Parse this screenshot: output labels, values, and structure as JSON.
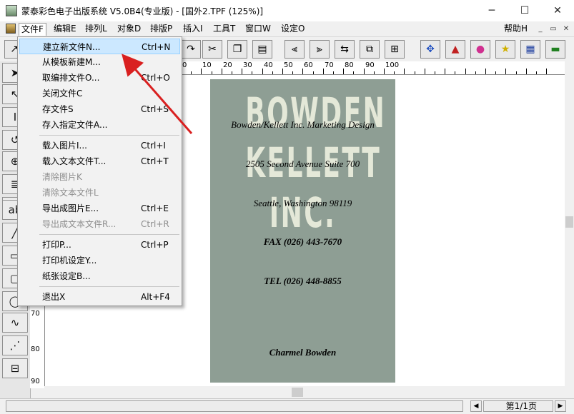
{
  "window": {
    "title": "蒙泰彩色电子出版系统 V5.0B4(专业版) - [国外2.TPF (125%)]",
    "minimize_glyph": "─",
    "maximize_glyph": "☐",
    "close_glyph": "✕"
  },
  "menubar": {
    "items": [
      "文件F",
      "编辑E",
      "排列L",
      "对象D",
      "排版P",
      "插入I",
      "工具T",
      "窗口W",
      "设定O"
    ],
    "help": "帮助H",
    "mdi_buttons": [
      "_",
      "▭",
      "✕"
    ]
  },
  "file_menu": {
    "groups": [
      [
        {
          "label": "建立新文件N...",
          "shortcut": "Ctrl+N",
          "state": "highlighted"
        },
        {
          "label": "从模板新建M...",
          "shortcut": "",
          "state": "enabled"
        },
        {
          "label": "取编排文件O...",
          "shortcut": "Ctrl+O",
          "state": "enabled"
        },
        {
          "label": "关闭文件C",
          "shortcut": "",
          "state": "enabled"
        },
        {
          "label": "存文件S",
          "shortcut": "Ctrl+S",
          "state": "enabled"
        },
        {
          "label": "存入指定文件A...",
          "shortcut": "",
          "state": "enabled"
        }
      ],
      [
        {
          "label": "载入图片I...",
          "shortcut": "Ctrl+I",
          "state": "enabled"
        },
        {
          "label": "载入文本文件T...",
          "shortcut": "Ctrl+T",
          "state": "enabled"
        },
        {
          "label": "清除图片K",
          "shortcut": "",
          "state": "disabled"
        },
        {
          "label": "清除文本文件L",
          "shortcut": "",
          "state": "disabled"
        },
        {
          "label": "导出成图片E...",
          "shortcut": "Ctrl+E",
          "state": "enabled"
        },
        {
          "label": "导出成文本文件R...",
          "shortcut": "Ctrl+R",
          "state": "disabled"
        }
      ],
      [
        {
          "label": "打印P...",
          "shortcut": "Ctrl+P",
          "state": "enabled"
        },
        {
          "label": "打印机设定Y...",
          "shortcut": "",
          "state": "enabled"
        },
        {
          "label": "纸张设定B...",
          "shortcut": "",
          "state": "enabled"
        }
      ],
      [
        {
          "label": "退出X",
          "shortcut": "Alt+F4",
          "state": "enabled"
        }
      ]
    ]
  },
  "ruler": {
    "horizontal_labels": [
      "0",
      "10",
      "20",
      "30",
      "40",
      "50",
      "60",
      "70",
      "80",
      "90",
      "100"
    ],
    "vertical_labels": [
      "70",
      "80",
      "90"
    ]
  },
  "document": {
    "background_logo": "BOWDEN\nKELLETT\nINC.",
    "lines": [
      "Bowden/Kellett Inc.  Marketing Design",
      "2505 Second Avenue Suite 700",
      "Seattle, Washington 98119",
      "FAX (026) 443-7670",
      "TEL (026) 448-8855",
      "Charmel Bowden"
    ],
    "card_color": "#8e9e94"
  },
  "statusbar": {
    "page_indicator": "第1/1页"
  },
  "annotation": {
    "arrow_color": "#d92020"
  }
}
